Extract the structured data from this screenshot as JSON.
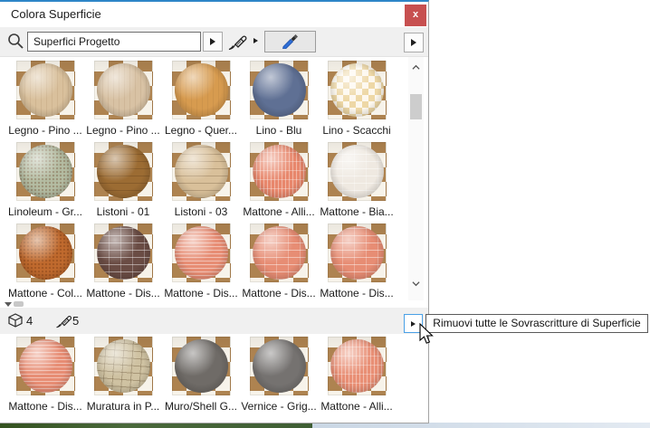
{
  "window": {
    "title": "Colora Superficie",
    "close_label": "x",
    "accent_border_color": "#2e86c8",
    "close_color": "#c75050"
  },
  "toolbar": {
    "search_value": "Superfici Progetto",
    "search_icon": "magnifier",
    "dropdown_icon": "arrow-right",
    "paintbrush_icon": "paintbrush",
    "eyedropper_icon": "eyedropper",
    "panel_icon": "arrow-right"
  },
  "grid": {
    "items": [
      {
        "label": "Legno - Pino ...",
        "color": "#d9c09c",
        "pattern": "wood"
      },
      {
        "label": "Legno - Pino ...",
        "color": "#d8c2a4",
        "pattern": "wood"
      },
      {
        "label": "Legno - Quer...",
        "color": "#d79b4f",
        "pattern": "wood"
      },
      {
        "label": "Lino - Blu",
        "color": "#5f7094",
        "pattern": "plain"
      },
      {
        "label": "Lino - Scacchi",
        "color": "#eed8a6",
        "pattern": "checker"
      },
      {
        "label": "Linoleum - Gr...",
        "color": "#b4bca2",
        "pattern": "plain"
      },
      {
        "label": "Listoni - 01",
        "color": "#9c6c33",
        "pattern": "planks"
      },
      {
        "label": "Listoni - 03",
        "color": "#d9c09a",
        "pattern": "planks"
      },
      {
        "label": "Mattone - Alli...",
        "color": "#e8876c",
        "pattern": "brick-v"
      },
      {
        "label": "Mattone - Bia...",
        "color": "#efe9e1",
        "pattern": "brick"
      },
      {
        "label": "Mattone - Col...",
        "color": "#c06a2e",
        "pattern": "speckle"
      },
      {
        "label": "Mattone - Dis...",
        "color": "#6a4c44",
        "pattern": "brick"
      },
      {
        "label": "Mattone - Dis...",
        "color": "#e78d74",
        "pattern": "brick-fine"
      },
      {
        "label": "Mattone - Dis...",
        "color": "#e78d74",
        "pattern": "brick"
      },
      {
        "label": "Mattone - Dis...",
        "color": "#e78d74",
        "pattern": "brick"
      }
    ]
  },
  "status": {
    "model_icon": "cube",
    "model_count": "4",
    "paint_icon": "paintbrush",
    "override_count": "5",
    "remove_icon": "arrow-right"
  },
  "tooltip": {
    "text": "Rimuovi tutte le Sovrascritture di Superficie"
  },
  "bottom": {
    "items": [
      {
        "label": "Mattone - Dis...",
        "color": "#e78d74",
        "pattern": "brick-fine"
      },
      {
        "label": "Muratura in P...",
        "color": "#cfc2a2",
        "pattern": "stone"
      },
      {
        "label": "Muro/Shell G...",
        "color": "#6f6b67",
        "pattern": "plain"
      },
      {
        "label": "Vernice - Grig...",
        "color": "#757270",
        "pattern": "plain"
      },
      {
        "label": "Mattone - Alli...",
        "color": "#e98f75",
        "pattern": "brick-v"
      }
    ]
  }
}
